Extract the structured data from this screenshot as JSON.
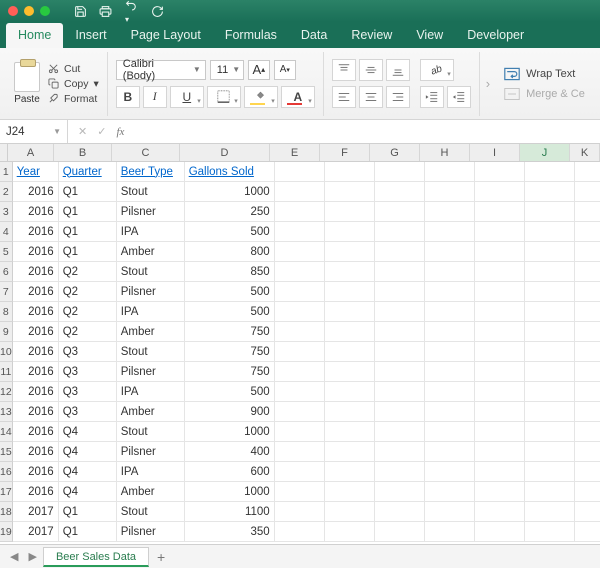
{
  "qat": {
    "save": "save-icon",
    "new": "new-icon",
    "undo": "undo-icon",
    "repeat": "repeat-icon"
  },
  "tabs": [
    "Home",
    "Insert",
    "Page Layout",
    "Formulas",
    "Data",
    "Review",
    "View",
    "Developer"
  ],
  "active_tab": 0,
  "clipboard": {
    "paste": "Paste",
    "cut": "Cut",
    "copy": "Copy",
    "format": "Format"
  },
  "font": {
    "name": "Calibri (Body)",
    "size": "11",
    "inc": "A",
    "dec": "A",
    "bold": "B",
    "italic": "I",
    "underline": "U"
  },
  "wrap": {
    "wrap": "Wrap Text",
    "merge": "Merge & Ce"
  },
  "namebox": "J24",
  "fx_value": "",
  "columns": [
    "A",
    "B",
    "C",
    "D",
    "E",
    "F",
    "G",
    "H",
    "I",
    "J",
    "K"
  ],
  "selected_col_index": 9,
  "headers": [
    "Year",
    "Quarter",
    "Beer Type",
    "Gallons Sold"
  ],
  "rows": [
    {
      "r": 2,
      "year": 2016,
      "quarter": "Q1",
      "type": "Stout",
      "gallons": 1000
    },
    {
      "r": 3,
      "year": 2016,
      "quarter": "Q1",
      "type": "Pilsner",
      "gallons": 250
    },
    {
      "r": 4,
      "year": 2016,
      "quarter": "Q1",
      "type": "IPA",
      "gallons": 500
    },
    {
      "r": 5,
      "year": 2016,
      "quarter": "Q1",
      "type": "Amber",
      "gallons": 800
    },
    {
      "r": 6,
      "year": 2016,
      "quarter": "Q2",
      "type": "Stout",
      "gallons": 850
    },
    {
      "r": 7,
      "year": 2016,
      "quarter": "Q2",
      "type": "Pilsner",
      "gallons": 500
    },
    {
      "r": 8,
      "year": 2016,
      "quarter": "Q2",
      "type": "IPA",
      "gallons": 500
    },
    {
      "r": 9,
      "year": 2016,
      "quarter": "Q2",
      "type": "Amber",
      "gallons": 750
    },
    {
      "r": 10,
      "year": 2016,
      "quarter": "Q3",
      "type": "Stout",
      "gallons": 750
    },
    {
      "r": 11,
      "year": 2016,
      "quarter": "Q3",
      "type": "Pilsner",
      "gallons": 750
    },
    {
      "r": 12,
      "year": 2016,
      "quarter": "Q3",
      "type": "IPA",
      "gallons": 500
    },
    {
      "r": 13,
      "year": 2016,
      "quarter": "Q3",
      "type": "Amber",
      "gallons": 900
    },
    {
      "r": 14,
      "year": 2016,
      "quarter": "Q4",
      "type": "Stout",
      "gallons": 1000
    },
    {
      "r": 15,
      "year": 2016,
      "quarter": "Q4",
      "type": "Pilsner",
      "gallons": 400
    },
    {
      "r": 16,
      "year": 2016,
      "quarter": "Q4",
      "type": "IPA",
      "gallons": 600
    },
    {
      "r": 17,
      "year": 2016,
      "quarter": "Q4",
      "type": "Amber",
      "gallons": 1000
    },
    {
      "r": 18,
      "year": 2017,
      "quarter": "Q1",
      "type": "Stout",
      "gallons": 1100
    },
    {
      "r": 19,
      "year": 2017,
      "quarter": "Q1",
      "type": "Pilsner",
      "gallons": 350
    }
  ],
  "sheet_tab": "Beer Sales Data"
}
